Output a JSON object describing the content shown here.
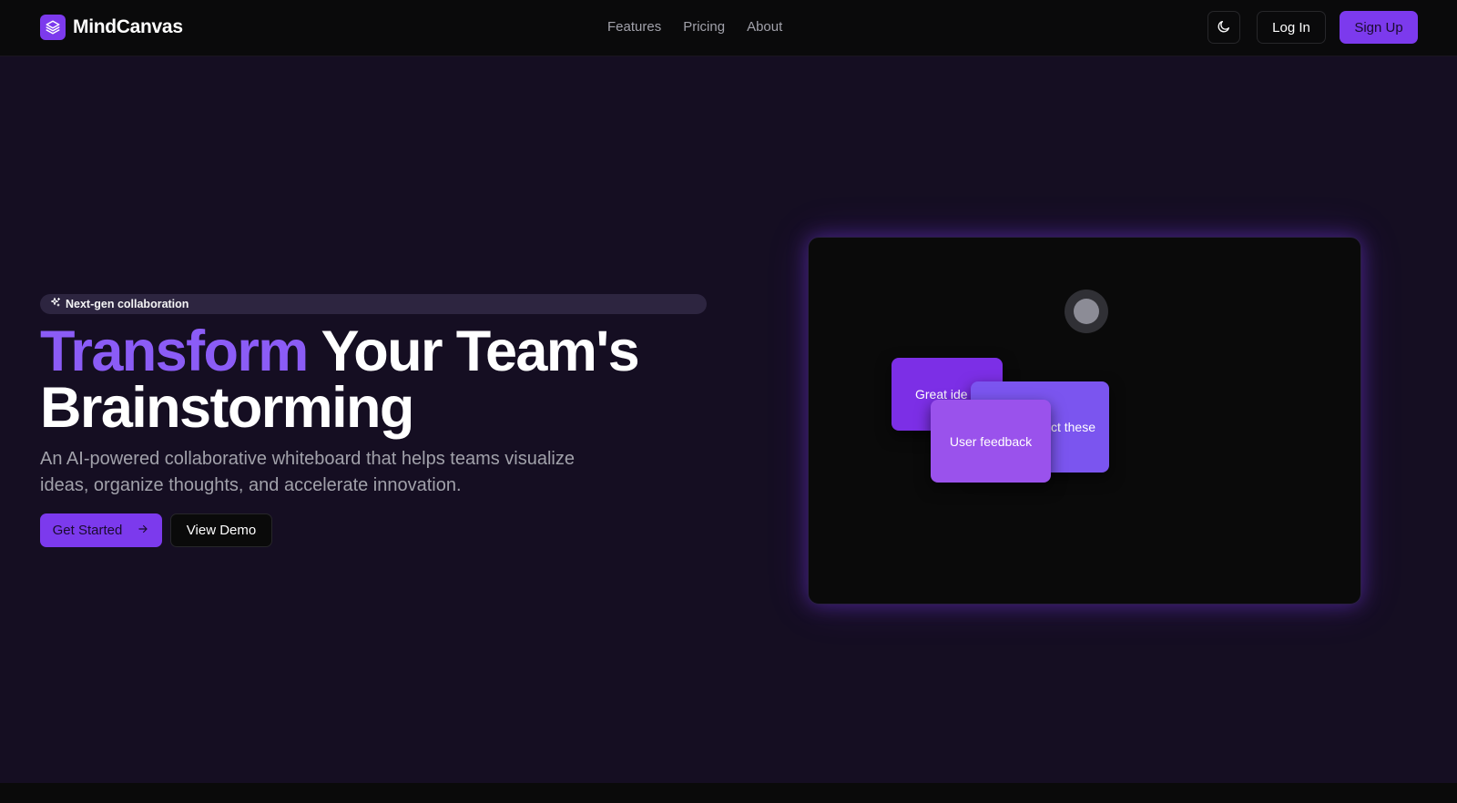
{
  "brand": {
    "name": "MindCanvas",
    "logo_icon": "layers-icon"
  },
  "nav": {
    "links": [
      "Features",
      "Pricing",
      "About"
    ]
  },
  "header_actions": {
    "theme_icon": "moon-icon",
    "login_label": "Log In",
    "signup_label": "Sign Up"
  },
  "hero": {
    "badge": "Next-gen collaboration",
    "badge_icon": "sparkles-icon",
    "headline_accent": "Transform",
    "headline_rest": " Your Team's Brainstorming",
    "subtitle": "An AI-powered collaborative whiteboard that helps teams visualize ideas, organize thoughts, and accelerate innovation.",
    "primary_cta": "Get Started",
    "primary_cta_icon": "arrow-right-icon",
    "secondary_cta": "View Demo"
  },
  "canvas": {
    "notes": [
      {
        "text": "Great ideas",
        "visible_text": "Great ide"
      },
      {
        "text": "Connect these",
        "visible_text": "ct these"
      },
      {
        "text": "User feedback",
        "visible_text": "User feedback"
      }
    ]
  },
  "colors": {
    "accent": "#7c3aed",
    "background": "#150e22",
    "panel": "#0a0a0a"
  }
}
